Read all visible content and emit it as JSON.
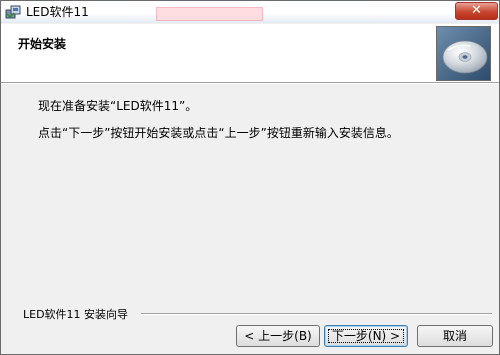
{
  "window": {
    "title": "LED软件11",
    "close_glyph": "✕",
    "icon": "installer-icon"
  },
  "header": {
    "title": "开始安装",
    "icon": "cd-disc-icon"
  },
  "body": {
    "line1": "现在准备安装“LED软件11”。",
    "line2": "点击“下一步”按钮开始安装或点击“上一步”按钮重新输入安装信息。"
  },
  "footer": {
    "brand": "LED软件11 安装向导",
    "back_label": "< 上一步(B)",
    "next_label": "下一步(N) >",
    "cancel_label": "取消"
  },
  "colors": {
    "close_red": "#c7462f",
    "default_button_border": "#3c7fb1"
  }
}
